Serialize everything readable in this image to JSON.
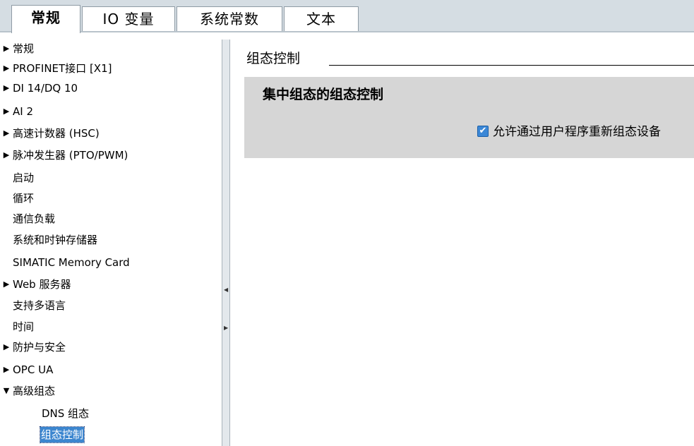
{
  "tabs": [
    {
      "label": "常规",
      "active": true
    },
    {
      "label": "IO 变量",
      "active": false
    },
    {
      "label": "系统常数",
      "active": false
    },
    {
      "label": "文本",
      "active": false
    }
  ],
  "tree": {
    "items": [
      {
        "label": "常规",
        "arrow": "right"
      },
      {
        "label": "PROFINET接口 [X1]",
        "arrow": "right"
      },
      {
        "label": "DI 14/DQ 10",
        "arrow": "right"
      },
      {
        "label": "AI 2",
        "arrow": "right"
      },
      {
        "label": "高速计数器 (HSC)",
        "arrow": "right"
      },
      {
        "label": "脉冲发生器 (PTO/PWM)",
        "arrow": "right"
      },
      {
        "label": "启动",
        "arrow": ""
      },
      {
        "label": "循环",
        "arrow": ""
      },
      {
        "label": "通信负载",
        "arrow": ""
      },
      {
        "label": "系统和时钟存储器",
        "arrow": ""
      },
      {
        "label": "SIMATIC Memory Card",
        "arrow": ""
      },
      {
        "label": "Web 服务器",
        "arrow": "right"
      },
      {
        "label": "支持多语言",
        "arrow": ""
      },
      {
        "label": "时间",
        "arrow": ""
      },
      {
        "label": "防护与安全",
        "arrow": "right"
      },
      {
        "label": "OPC UA",
        "arrow": "right"
      },
      {
        "label": "高级组态",
        "arrow": "down"
      },
      {
        "label": "DNS 组态",
        "arrow": ""
      },
      {
        "label": "组态控制",
        "arrow": "",
        "selected": true
      }
    ]
  },
  "main": {
    "section_title": "组态控制",
    "panel_title": "集中组态的组态控制",
    "checkbox_label": "允许通过用户程序重新组态设备",
    "checkbox_checked": true
  },
  "icons": {
    "arrow_right": "▶",
    "arrow_down": "▼",
    "collapse_left": "◀",
    "expand_right": "▶",
    "check": "✔"
  },
  "colors": {
    "tabbar_bg": "#d5dde3",
    "selection_bg": "#3c86cf",
    "panel_bg": "#d6d6d6",
    "checkbox_fill": "#3b87d6"
  }
}
